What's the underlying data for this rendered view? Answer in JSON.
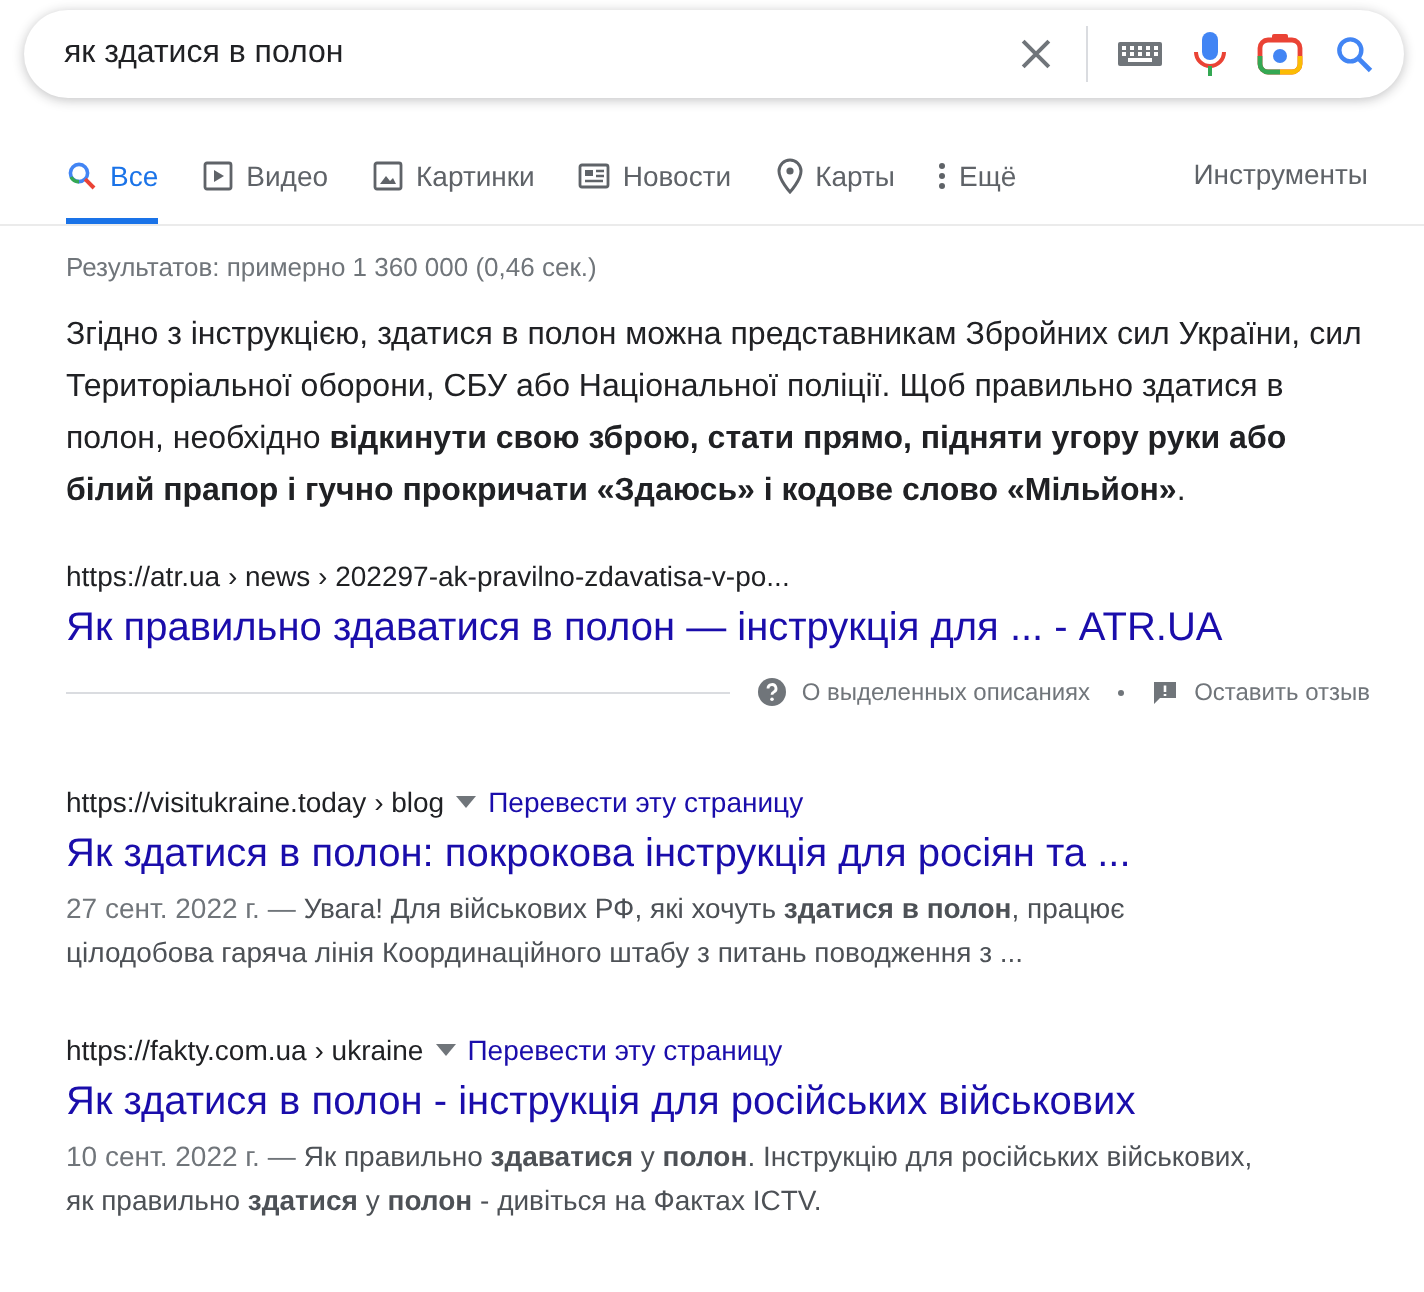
{
  "search": {
    "value": "як здатися в полон"
  },
  "tabs": [
    {
      "label": "Все",
      "kind": "search",
      "selected": true
    },
    {
      "label": "Видео",
      "kind": "video",
      "selected": false
    },
    {
      "label": "Картинки",
      "kind": "image",
      "selected": false
    },
    {
      "label": "Новости",
      "kind": "news",
      "selected": false
    },
    {
      "label": "Карты",
      "kind": "map",
      "selected": false
    },
    {
      "label": "Ещё",
      "kind": "more",
      "selected": false
    }
  ],
  "tools": "Инструменты",
  "stats": "Результатов: примерно 1 360 000 (0,46 сек.)",
  "featured": {
    "snippet": "Згідно з інструкцією, здатися в полон можна представникам Збройних сил України, сил Територіальної оборони, СБУ або Національної поліції. Щоб правильно здатися в полон, необхідно **відкинути свою зброю, стати прямо, підняти угору руки або білий прапор і гучно прокричати «Здаюсь» і кодове слово «Мільйон»**.",
    "url": "https://atr.ua › news › 202297-ak-pravilno-zdavatisa-v-po...",
    "title": "Як правильно здаватися в полон — інструкція для ... - ATR.UA",
    "about": "О выделенных описаниях",
    "feedback": "Оставить отзыв"
  },
  "results": [
    {
      "url": "https://visitukraine.today › blog",
      "translate": "Перевести эту страницу",
      "title": "Як здатися в полон: покрокова інструкція для росіян та ...",
      "date": "27 сент. 2022 г. —",
      "snippet": "Увага! Для військових РФ, які хочуть **здатися в полон**, працює цілодобова гаряча лінія Координаційного штабу з питань поводження з ..."
    },
    {
      "url": "https://fakty.com.ua › ukraine",
      "translate": "Перевести эту страницу",
      "title": "Як здатися в полон - інструкція для російських військових",
      "date": "10 сент. 2022 г. —",
      "snippet": "Як правильно **здаватися** у **полон**. Інструкцію для російських військових, як правильно **здатися** у **полон** - дивіться на Фактах ICTV."
    }
  ]
}
